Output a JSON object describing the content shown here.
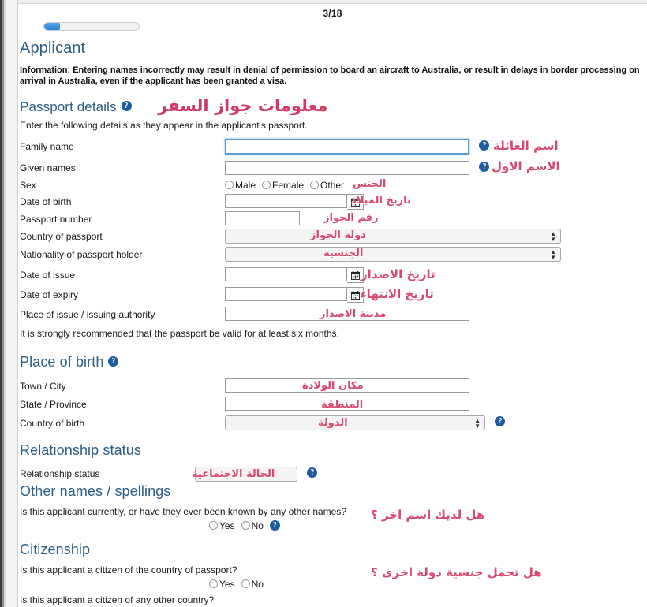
{
  "header": {
    "page_indicator": "3/18",
    "progress_percent": 17
  },
  "applicant": {
    "title": "Applicant",
    "information_note": "Information: Entering names incorrectly may result in denial of permission to board an aircraft to Australia, or result in delays in border processing on arrival in Australia, even if the applicant has been granted a visa."
  },
  "passport": {
    "title": "Passport details",
    "annotation": "معلومات جواز السفر",
    "lede": "Enter the following details as they appear in the applicant's passport.",
    "family_name_label": "Family name",
    "family_name_value": "",
    "family_name_annotation": "اسم العائلة",
    "given_names_label": "Given names",
    "given_names_value": "",
    "given_names_annotation": "الاسم الاول",
    "sex_label": "Sex",
    "sex_options": [
      "Male",
      "Female",
      "Other"
    ],
    "sex_annotation": "الجنس",
    "dob_label": "Date of birth",
    "dob_value": "",
    "dob_annotation": "تاريخ الميلاد",
    "passport_number_label": "Passport number",
    "passport_number_value": "",
    "passport_number_annotation": "رقم الجواز",
    "country_label": "Country of passport",
    "country_value": "",
    "country_annotation": "دولة الجواز",
    "nationality_label": "Nationality of passport holder",
    "nationality_value": "",
    "nationality_annotation": "الجنسية",
    "issue_label": "Date of issue",
    "issue_value": "",
    "issue_annotation": "تاريخ الاصدار",
    "expiry_label": "Date of expiry",
    "expiry_value": "",
    "expiry_annotation": "تاريخ الانتهاء",
    "place_issue_label": "Place of issue / issuing authority",
    "place_issue_value": "",
    "place_issue_annotation": "مدينة الاصدار",
    "validity_note": "It is strongly recommended that the passport be valid for at least six months."
  },
  "place_of_birth": {
    "title": "Place of birth",
    "town_label": "Town / City",
    "town_value": "",
    "town_annotation": "مكان الولادة",
    "state_label": "State / Province",
    "state_value": "",
    "state_annotation": "المنطقة",
    "country_label": "Country of birth",
    "country_value": "",
    "country_annotation": "الدولة"
  },
  "relationship": {
    "title": "Relationship status",
    "field_label": "Relationship status",
    "value": "",
    "annotation": "الحالة الاجتماعية"
  },
  "other_names": {
    "title": "Other names / spellings",
    "question": "Is this applicant currently, or have they ever been known by any other names?",
    "options": [
      "Yes",
      "No"
    ],
    "annotation": "هل لديك اسم اخر ؟"
  },
  "citizenship": {
    "title": "Citizenship",
    "question_1": "Is this applicant a citizen of the country of passport?",
    "options_1": [
      "Yes",
      "No"
    ],
    "annotation_1": "هل تحمل جنسية دولة اخرى ؟",
    "question_2": "Is this applicant a citizen of any other country?"
  },
  "icons": {
    "help": "?",
    "calendar": "calendar-icon",
    "spinner": "▲▼"
  },
  "colors": {
    "heading": "#2e5d86",
    "annotation": "#d9486f",
    "progress": "#2f7fd1",
    "focus": "#5b9bd5"
  }
}
